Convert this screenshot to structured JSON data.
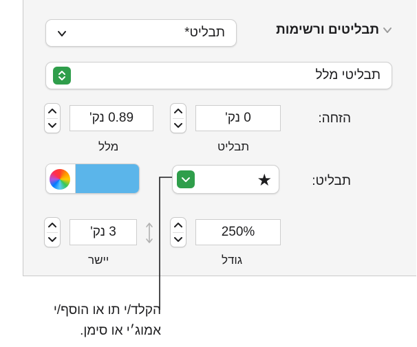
{
  "section": {
    "title": "תבליטים ורשימות",
    "chevron_icon": "chevron-down-icon"
  },
  "list_style_popup": {
    "value": "תבליט*"
  },
  "bullet_type_popup": {
    "value": "תבליטי מלל"
  },
  "indent": {
    "label": "הזחה:",
    "bullet": {
      "value": "0 נק'",
      "caption": "תבליט"
    },
    "text": {
      "value": "0.89 נק'",
      "caption": "מלל"
    }
  },
  "bullet_row": {
    "label": "תבליט:",
    "bullet_char": "★",
    "color_swatch": "#5bb5ea"
  },
  "size": {
    "value": "250%",
    "caption": "גודל"
  },
  "align": {
    "value": "3 נק'",
    "caption": "יישר"
  },
  "callout": {
    "line1": "הקלד/י תו או הוסף/י",
    "line2": "אמוג׳י או סימן."
  },
  "colors": {
    "accent_green": "#2f9e4b",
    "panel": "#f5f5f5"
  }
}
